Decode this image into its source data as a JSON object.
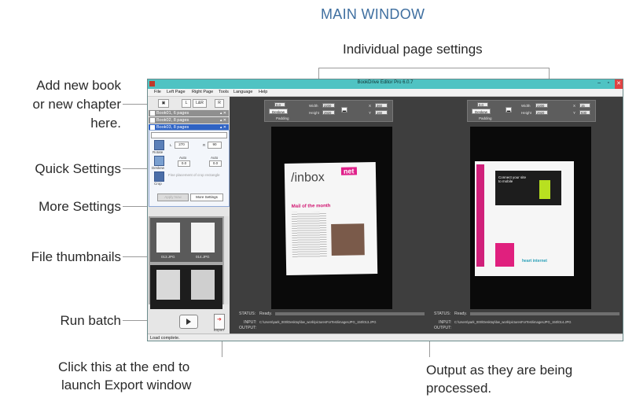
{
  "heading": "MAIN WINDOW",
  "callouts": {
    "individual": "Individual page settings",
    "add_book_1": "Add new book",
    "add_book_2": "or new chapter",
    "add_book_3": "here.",
    "quick": "Quick Settings",
    "more": "More Settings",
    "thumbs": "File thumbnails",
    "run": "Run batch",
    "export_1": "Click this at the end to",
    "export_2": "launch Export window",
    "output_1": "Output as they are being",
    "output_2": "processed."
  },
  "window": {
    "title": "BookDrive Editor Pro 6.0.7",
    "menu": [
      "File",
      "Left Page",
      "Right Page",
      "Tools",
      "Language",
      "Help"
    ]
  },
  "left_panel": {
    "tool_buttons": [
      "L",
      "L&R",
      "R"
    ],
    "books": [
      {
        "label": "Book01, 6 pages",
        "color": "#8f8f8f"
      },
      {
        "label": "Book02, 8 pages",
        "color": "#8f8f8f"
      },
      {
        "label": "Book03, 8 pages",
        "color": "#2f63c4"
      }
    ],
    "quick_settings": {
      "l_label": "L",
      "l_value": "270",
      "r_label": "R",
      "r_value": "90",
      "rotate": "Rotate",
      "deskew": "Deskew",
      "crop": "Crop",
      "auto1": "Auto",
      "auto2": "Auto",
      "dial1": "0.0",
      "dial2": "0.0",
      "fine": "Fine placement of crop rectangle",
      "apply_btn": "Apply Now",
      "more_btn": "More Settings"
    },
    "thumbnails": [
      {
        "left": "013.JPG",
        "right": "014.JPG"
      }
    ],
    "export_label": "Export"
  },
  "page_controls": {
    "left": {
      "angle": "0.0",
      "width_label": "Width",
      "width_value": "2200",
      "height_label": "Height",
      "height_value": "2920",
      "x_label": "X",
      "x_value": "360",
      "y_label": "Y",
      "y_value": "160",
      "deskew": "Deskew",
      "padding": "Padding"
    },
    "right": {
      "angle": "0.0",
      "width_label": "Width",
      "width_value": "2200",
      "height_label": "Height",
      "height_value": "2920",
      "x_label": "X",
      "x_value": "15",
      "y_label": "Y",
      "y_value": "630",
      "deskew": "Deskew",
      "padding": "Padding"
    }
  },
  "pages": {
    "left_mag_title": "/inbox",
    "left_mag_sub": "Mail of the month",
    "left_mag_brand": "net",
    "right_mag_text": "Connect your site to mobile",
    "right_mag_brand": "heart internet"
  },
  "status": {
    "left": {
      "status_label": "STATUS:",
      "status_value": "Ready.",
      "input_label": "INPUT:",
      "input_value": "C:\\Users\\park_000\\Desktop\\bw_work\\picturesForTest\\imagesJPG_150\\013.JPG",
      "output_label": "OUTPUT:"
    },
    "right": {
      "status_label": "STATUS:",
      "status_value": "Ready.",
      "input_label": "INPUT:",
      "input_value": "C:\\Users\\park_000\\Desktop\\bw_work\\picturesForTest\\imagesJPG_150\\014.JPG",
      "output_label": "OUTPUT:"
    }
  },
  "statusbar": "Load complete."
}
